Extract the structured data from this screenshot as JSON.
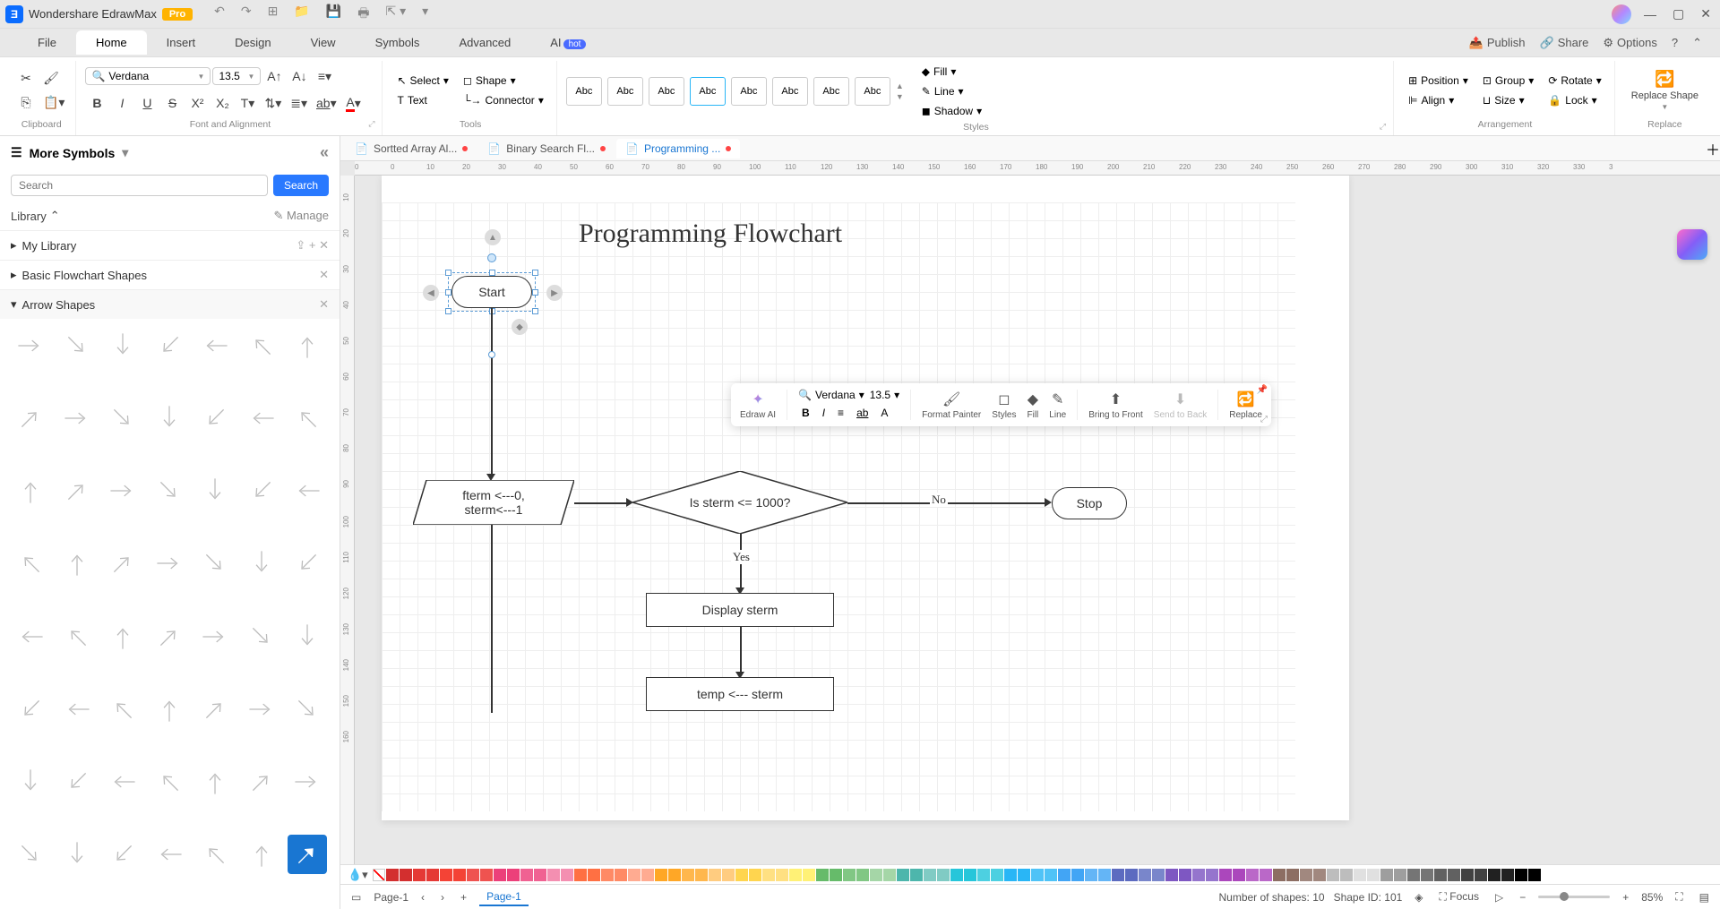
{
  "app": {
    "name": "Wondershare EdrawMax",
    "badge": "Pro"
  },
  "menubar": {
    "items": [
      "File",
      "Home",
      "Insert",
      "Design",
      "View",
      "Symbols",
      "Advanced"
    ],
    "ai": "AI",
    "hot": "hot",
    "right": {
      "publish": "Publish",
      "share": "Share",
      "options": "Options"
    }
  },
  "ribbon": {
    "clipboard_label": "Clipboard",
    "font": {
      "name": "Verdana",
      "size": "13.5",
      "label": "Font and Alignment"
    },
    "tools": {
      "select": "Select",
      "text": "Text",
      "shape": "Shape",
      "connector": "Connector",
      "label": "Tools"
    },
    "styles": {
      "swatch": "Abc",
      "label": "Styles",
      "fill": "Fill",
      "line": "Line",
      "shadow": "Shadow"
    },
    "arrangement": {
      "position": "Position",
      "align": "Align",
      "group": "Group",
      "size": "Size",
      "rotate": "Rotate",
      "lock": "Lock",
      "label": "Arrangement"
    },
    "replace": {
      "main": "Replace Shape",
      "label": "Replace"
    }
  },
  "sidebar": {
    "title": "More Symbols",
    "search_placeholder": "Search",
    "search_btn": "Search",
    "library": "Library",
    "manage": "Manage",
    "my_library": "My Library",
    "cat1": "Basic Flowchart Shapes",
    "cat2": "Arrow Shapes"
  },
  "tabs": [
    {
      "name": "Sortted Array Al...",
      "dirty": true,
      "active": false
    },
    {
      "name": "Binary Search Fl...",
      "dirty": true,
      "active": false
    },
    {
      "name": "Programming ...",
      "dirty": true,
      "active": true
    }
  ],
  "ruler_h": [
    "0",
    "0",
    "10",
    "20",
    "30",
    "40",
    "50",
    "60",
    "70",
    "80",
    "90",
    "100",
    "110",
    "120",
    "130",
    "140",
    "150",
    "160",
    "170",
    "180",
    "190",
    "200",
    "210",
    "220",
    "230",
    "240",
    "250",
    "260",
    "270",
    "280",
    "290",
    "300",
    "310",
    "320",
    "330",
    "3"
  ],
  "ruler_v": [
    "10",
    "20",
    "30",
    "40",
    "50",
    "60",
    "70",
    "80",
    "90",
    "100",
    "110",
    "120",
    "130",
    "140",
    "150",
    "160"
  ],
  "canvas": {
    "title": "Programming Flowchart",
    "start": "Start",
    "assign": "fterm <---0,\nsterm<---1",
    "decision": "Is sterm <= 1000?",
    "yes": "Yes",
    "no": "No",
    "display": "Display sterm",
    "temp": "temp <--- sterm",
    "stop": "Stop"
  },
  "float_tb": {
    "font": "Verdana",
    "size": "13.5",
    "edraw_ai": "Edraw AI",
    "format_painter": "Format Painter",
    "styles": "Styles",
    "fill": "Fill",
    "line": "Line",
    "bring_front": "Bring to Front",
    "send_back": "Send to Back",
    "replace": "Replace"
  },
  "colors": [
    "#d32f2f",
    "#e53935",
    "#f44336",
    "#ef5350",
    "#ec407a",
    "#f06292",
    "#f48fb1",
    "#ff7043",
    "#ff8a65",
    "#ffab91",
    "#ffa726",
    "#ffb74d",
    "#ffcc80",
    "#ffd54f",
    "#ffe082",
    "#fff176",
    "#66bb6a",
    "#81c784",
    "#a5d6a7",
    "#4db6ac",
    "#80cbc4",
    "#26c6da",
    "#4dd0e1",
    "#29b6f6",
    "#4fc3f7",
    "#42a5f5",
    "#64b5f6",
    "#5c6bc0",
    "#7986cb",
    "#7e57c2",
    "#9575cd",
    "#ab47bc",
    "#ba68c8",
    "#8d6e63",
    "#a1887f",
    "#bdbdbd",
    "#e0e0e0",
    "#9e9e9e",
    "#757575",
    "#616161",
    "#424242",
    "#212121",
    "#000000"
  ],
  "statusbar": {
    "page": "Page-1",
    "page_tab": "Page-1",
    "shapes": "Number of shapes: 10",
    "shape_id": "Shape ID: 101",
    "focus": "Focus",
    "zoom": "85%"
  }
}
